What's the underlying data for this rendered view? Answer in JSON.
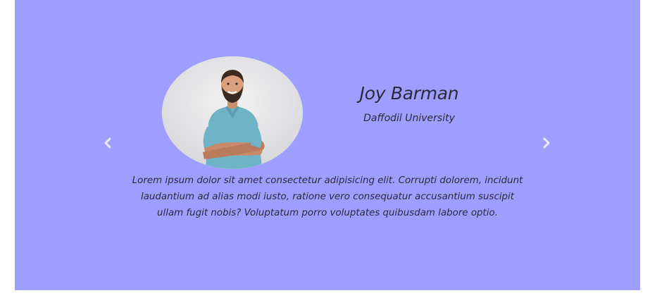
{
  "carousel": {
    "background_color": "#9e9eff",
    "prev_icon": "chevron-left-icon",
    "next_icon": "chevron-right-icon",
    "slide": {
      "name": "Joy Barman",
      "organization": "Daffodil University",
      "quote": "Lorem ipsum dolor sit amet consectetur adipisicing elit. Corrupti dolorem, incidunt laudantium ad alias modi iusto, ratione vero consequatur accusantium suscipit ullam fugit nobis? Voluptatum porro voluptates quibusdam labore optio.",
      "photo_icon": "person-photo"
    }
  }
}
